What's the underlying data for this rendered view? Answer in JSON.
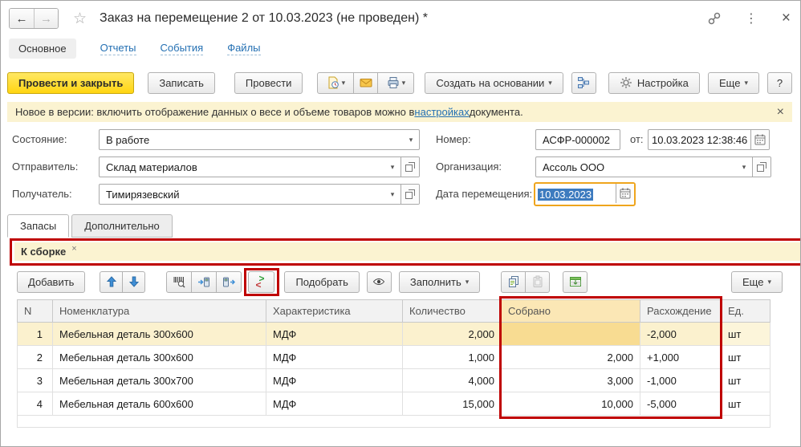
{
  "icons": {
    "back": "←",
    "forward": "→",
    "star": "☆",
    "kebab": "⋮",
    "close": "×",
    "caret": "▾",
    "banner_close": "×",
    "chip_close": "×",
    "compare_gt": ">",
    "compare_lt": "<"
  },
  "window_header": {
    "title": "Заказ на перемещение 2 от 10.03.2023 (не проведен) *"
  },
  "nav": {
    "items": [
      {
        "label": "Основное"
      },
      {
        "label": "Отчеты"
      },
      {
        "label": "События"
      },
      {
        "label": "Файлы"
      }
    ]
  },
  "toolbar": {
    "post_and_close": "Провести и закрыть",
    "save": "Записать",
    "post": "Провести",
    "create_based_on": "Создать на основании",
    "settings": "Настройка",
    "more": "Еще",
    "help": "?"
  },
  "banner": {
    "text_before": "Новое в версии: включить отображение данных о весе и объеме товаров можно в ",
    "link_text": "настройках",
    "text_after": " документа."
  },
  "fields": {
    "state": {
      "label": "Состояние:",
      "value": "В работе"
    },
    "sender": {
      "label": "Отправитель:",
      "value": "Склад материалов"
    },
    "receiver": {
      "label": "Получатель:",
      "value": "Тимирязевский"
    },
    "number": {
      "label": "Номер:",
      "value": "АСФР-000002"
    },
    "date": {
      "label": "от:",
      "value": "10.03.2023 12:38:46"
    },
    "organization": {
      "label": "Организация:",
      "value": "Ассоль ООО"
    },
    "move_date": {
      "label": "Дата перемещения:",
      "value": "10.03.2023"
    }
  },
  "tabs": {
    "items": [
      {
        "label": "Запасы"
      },
      {
        "label": "Дополнительно"
      }
    ]
  },
  "chip": {
    "label": "К сборке"
  },
  "table_toolbar": {
    "add": "Добавить",
    "pick": "Подобрать",
    "fill": "Заполнить",
    "more": "Еще"
  },
  "table": {
    "columns": [
      "N",
      "Номенклатура",
      "Характеристика",
      "Количество",
      "Собрано",
      "Расхождение",
      "Ед."
    ],
    "rows": [
      {
        "n": "1",
        "item": "Мебельная деталь 300x600",
        "char": "МДФ",
        "qty": "2,000",
        "collected": "",
        "diff": "-2,000",
        "unit": "шт"
      },
      {
        "n": "2",
        "item": "Мебельная деталь 300x600",
        "char": "МДФ",
        "qty": "1,000",
        "collected": "2,000",
        "diff": "+1,000",
        "unit": "шт"
      },
      {
        "n": "3",
        "item": "Мебельная деталь 300x700",
        "char": "МДФ",
        "qty": "4,000",
        "collected": "3,000",
        "diff": "-1,000",
        "unit": "шт"
      },
      {
        "n": "4",
        "item": "Мебельная деталь 600x600",
        "char": "МДФ",
        "qty": "15,000",
        "collected": "10,000",
        "diff": "-5,000",
        "unit": "шт"
      }
    ]
  },
  "colors": {
    "annotation_red": "#BF0000",
    "primary_button_yellow": "#FFD512",
    "banner_bg": "#FBF3D1",
    "link_blue": "#2470B3",
    "focus_border_orange": "#EFA51D",
    "collected_header_bg": "#FBE7B5",
    "current_row_bg": "#FBF1CE"
  }
}
